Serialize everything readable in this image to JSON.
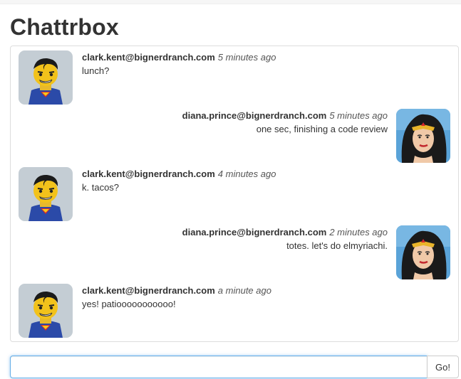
{
  "app": {
    "title": "Chattrbox"
  },
  "messages": [
    {
      "sender": "clark.kent@bignerdranch.com",
      "time": "5 minutes ago",
      "text": "lunch?",
      "side": "left",
      "avatar": "superman-avatar"
    },
    {
      "sender": "diana.prince@bignerdranch.com",
      "time": "5 minutes ago",
      "text": "one sec, finishing a code review",
      "side": "right",
      "avatar": "wonder-woman-avatar"
    },
    {
      "sender": "clark.kent@bignerdranch.com",
      "time": "4 minutes ago",
      "text": "k. tacos?",
      "side": "left",
      "avatar": "superman-avatar"
    },
    {
      "sender": "diana.prince@bignerdranch.com",
      "time": "2 minutes ago",
      "text": "totes. let's do elmyriachi.",
      "side": "right",
      "avatar": "wonder-woman-avatar"
    },
    {
      "sender": "clark.kent@bignerdranch.com",
      "time": "a minute ago",
      "text": "yes! patiooooooooooo!",
      "side": "left",
      "avatar": "superman-avatar"
    }
  ],
  "composer": {
    "input_value": "",
    "input_placeholder": "",
    "button_label": "Go!"
  },
  "colors": {
    "input_focus_border": "#66afe9",
    "panel_border": "#dddddd",
    "text": "#333333"
  }
}
